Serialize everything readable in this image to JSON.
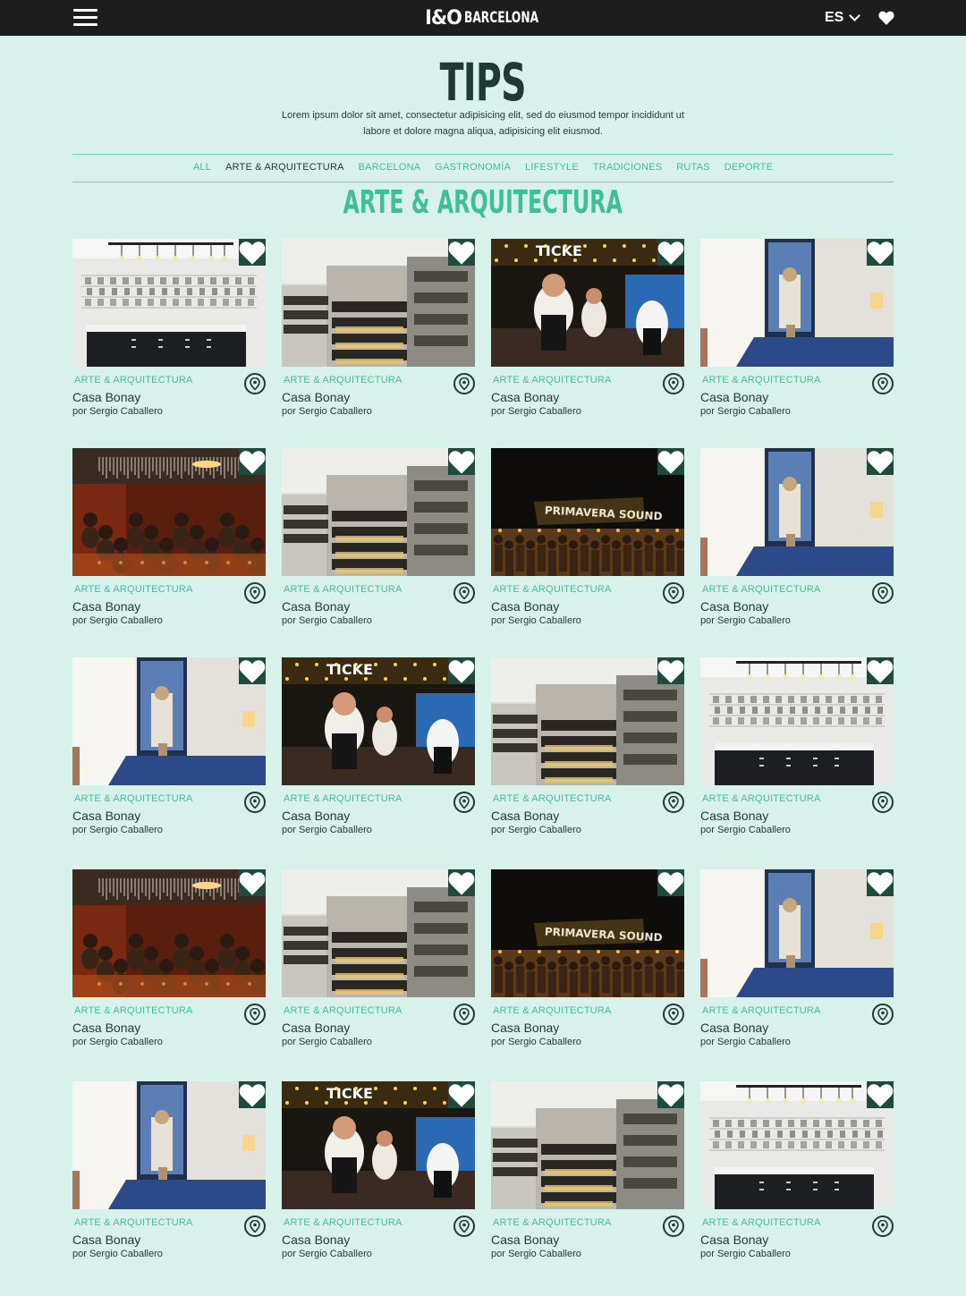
{
  "header": {
    "logo_mark": "I&O",
    "logo_text": "BARCELONA",
    "language": "ES"
  },
  "page": {
    "title": "TIPS",
    "intro": "Lorem ipsum dolor sit amet, consectetur adipisicing elit, sed do eiusmod tempor incididunt ut labore et dolore magna aliqua, adipisicing elit eiusmod."
  },
  "filters": [
    "ALL",
    "ARTE & ARQUITECTURA",
    "BARCELONA",
    "GASTRONOMÍA",
    "LIFESTYLE",
    "TRADICIONES",
    "RUTAS",
    "DEPORTE"
  ],
  "active_filter": "ARTE & ARQUITECTURA",
  "section_title": "ARTE & ARQUITECTURA",
  "colors": {
    "background": "#d8f1ea",
    "topbar": "#1d1d1e",
    "accent": "#3fbf96",
    "dark_green": "#1e3a33",
    "favorite_badge": "#1f4a3c"
  },
  "cards": [
    {
      "image": "store-interior",
      "category": "ARTE & ARQUITECTURA",
      "name": "Casa Bonay",
      "author": "por Sergio Caballero"
    },
    {
      "image": "city-rooftops",
      "category": "ARTE & ARQUITECTURA",
      "name": "Casa Bonay",
      "author": "por Sergio Caballero"
    },
    {
      "image": "chef-restaurant",
      "category": "ARTE & ARQUITECTURA",
      "name": "Casa Bonay",
      "author": "por Sergio Caballero"
    },
    {
      "image": "hotel-room",
      "category": "ARTE & ARQUITECTURA",
      "name": "Casa Bonay",
      "author": "por Sergio Caballero"
    },
    {
      "image": "dining-crowd",
      "category": "ARTE & ARQUITECTURA",
      "name": "Casa Bonay",
      "author": "por Sergio Caballero"
    },
    {
      "image": "city-rooftops",
      "category": "ARTE & ARQUITECTURA",
      "name": "Casa Bonay",
      "author": "por Sergio Caballero"
    },
    {
      "image": "primavera-sound",
      "category": "ARTE & ARQUITECTURA",
      "name": "Casa Bonay",
      "author": "por Sergio Caballero"
    },
    {
      "image": "hotel-room",
      "category": "ARTE & ARQUITECTURA",
      "name": "Casa Bonay",
      "author": "por Sergio Caballero"
    },
    {
      "image": "hotel-room",
      "category": "ARTE & ARQUITECTURA",
      "name": "Casa Bonay",
      "author": "por Sergio Caballero"
    },
    {
      "image": "chef-restaurant",
      "category": "ARTE & ARQUITECTURA",
      "name": "Casa Bonay",
      "author": "por Sergio Caballero"
    },
    {
      "image": "city-rooftops",
      "category": "ARTE & ARQUITECTURA",
      "name": "Casa Bonay",
      "author": "por Sergio Caballero"
    },
    {
      "image": "store-interior",
      "category": "ARTE & ARQUITECTURA",
      "name": "Casa Bonay",
      "author": "por Sergio Caballero"
    },
    {
      "image": "dining-crowd",
      "category": "ARTE & ARQUITECTURA",
      "name": "Casa Bonay",
      "author": "por Sergio Caballero"
    },
    {
      "image": "city-rooftops",
      "category": "ARTE & ARQUITECTURA",
      "name": "Casa Bonay",
      "author": "por Sergio Caballero"
    },
    {
      "image": "primavera-sound",
      "category": "ARTE & ARQUITECTURA",
      "name": "Casa Bonay",
      "author": "por Sergio Caballero"
    },
    {
      "image": "hotel-room",
      "category": "ARTE & ARQUITECTURA",
      "name": "Casa Bonay",
      "author": "por Sergio Caballero"
    },
    {
      "image": "hotel-room",
      "category": "ARTE & ARQUITECTURA",
      "name": "Casa Bonay",
      "author": "por Sergio Caballero"
    },
    {
      "image": "chef-restaurant",
      "category": "ARTE & ARQUITECTURA",
      "name": "Casa Bonay",
      "author": "por Sergio Caballero"
    },
    {
      "image": "city-rooftops",
      "category": "ARTE & ARQUITECTURA",
      "name": "Casa Bonay",
      "author": "por Sergio Caballero"
    },
    {
      "image": "store-interior",
      "category": "ARTE & ARQUITECTURA",
      "name": "Casa Bonay",
      "author": "por Sergio Caballero"
    }
  ],
  "image_texts": {
    "chef-restaurant": "TICKE",
    "primavera-sound": "PRIMAVERA SOUND"
  }
}
